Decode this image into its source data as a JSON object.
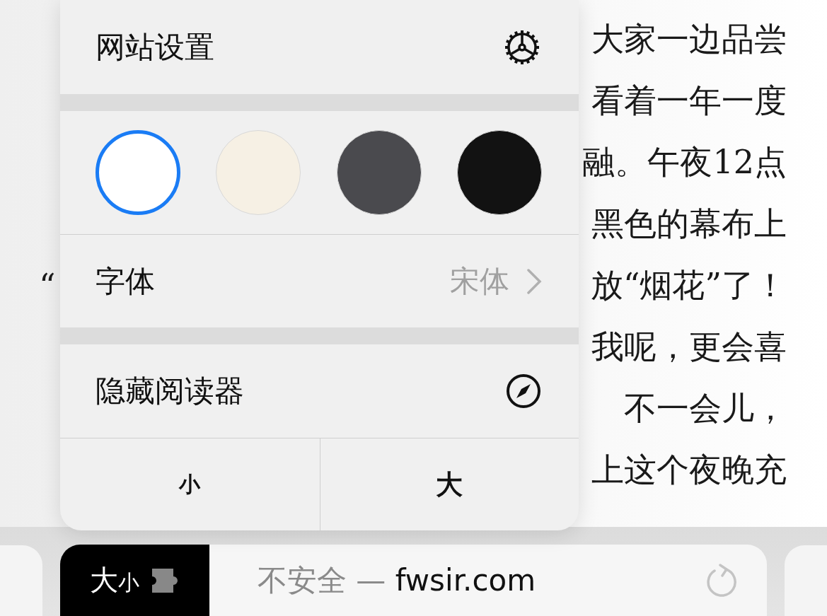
{
  "article": {
    "lines": [
      {
        "right": "大家一边品尝"
      },
      {
        "right": "看着一年一度"
      },
      {
        "right": "融。午夜12点"
      },
      {
        "right": "黑色的幕布上"
      },
      {
        "left": "“",
        "right": "放“烟花”了！"
      },
      {
        "right": "我呢，更会喜"
      },
      {
        "right": "不一会儿，"
      },
      {
        "right": "上这个夜晚充"
      }
    ]
  },
  "popup": {
    "title": "网站设置",
    "themes": [
      {
        "color": "#ffffff",
        "selected": true
      },
      {
        "color": "#f6f0e4",
        "selected": false
      },
      {
        "color": "#4a4a4e",
        "selected": false
      },
      {
        "color": "#121212",
        "selected": false
      }
    ],
    "font": {
      "label": "字体",
      "value": "宋体"
    },
    "hide_reader": "隐藏阅读器",
    "size_buttons": [
      "小",
      "大"
    ]
  },
  "address_bar": {
    "reader_button": {
      "big": "大",
      "small": "小"
    },
    "security": "不安全 —",
    "domain": "fwsir.com"
  }
}
